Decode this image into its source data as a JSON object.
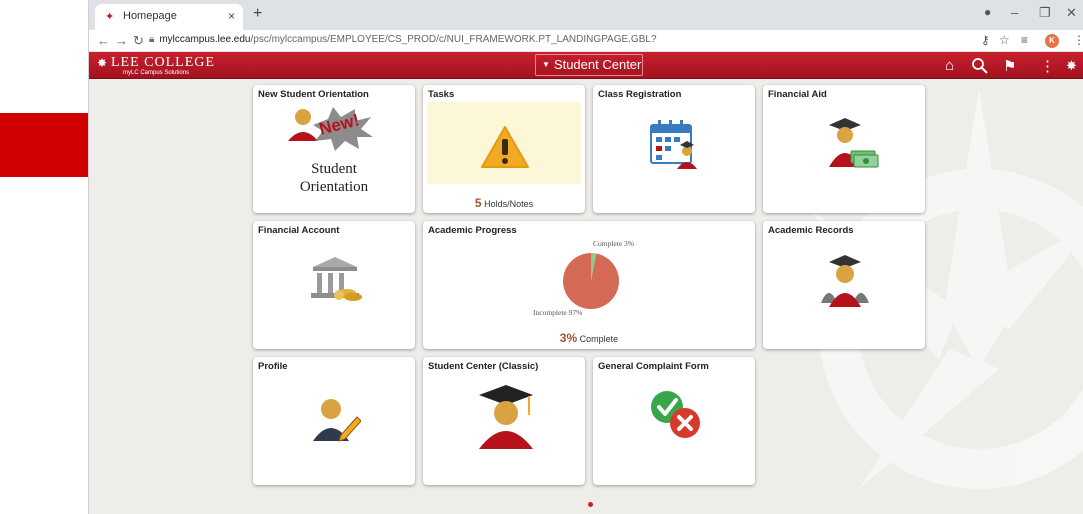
{
  "browser": {
    "tab_title": "Homepage",
    "tab_close": "×",
    "new_tab": "+",
    "url_domain": "mylccampus.lee.edu",
    "url_path": "/psc/mylccampus/EMPLOYEE/CS_PROD/c/NUI_FRAMEWORK.PT_LANDINGPAGE.GBL?",
    "profile_initial": "K",
    "window_controls": [
      "minimize-icon",
      "maximize-icon",
      "close-icon"
    ]
  },
  "header": {
    "logo_name": "LEE COLLEGE",
    "logo_sub": "myLC Campus Solutions",
    "nav_selector": "Student Center",
    "icons": [
      "home-icon",
      "search-icon",
      "flag-icon",
      "more-icon",
      "compass-icon"
    ]
  },
  "tiles": [
    {
      "title": "New Student Orientation",
      "badge": "New!",
      "caption_1": "Student",
      "caption_2": "Orientation",
      "icon": "person-icon"
    },
    {
      "title": "Tasks",
      "count": "5",
      "count_label": "Holds/Notes",
      "icon": "warning-icon"
    },
    {
      "title": "Class Registration",
      "icon": "calendar-icon"
    },
    {
      "title": "Financial Aid",
      "icon": "graduate-money-icon"
    },
    {
      "title": "Financial Account",
      "icon": "bank-icon"
    },
    {
      "title": "Academic Progress",
      "complete_label": "Complete 3%",
      "incomplete_label": "Incomplete 97%",
      "summary_value": "3%",
      "summary_label": "Complete",
      "icon": "pie-icon"
    },
    {
      "title": "Academic Records",
      "icon": "graduate-icon"
    },
    {
      "title": "Profile",
      "icon": "person-edit-icon"
    },
    {
      "title": "Student Center (Classic)",
      "icon": "graduate-icon"
    },
    {
      "title": "General Complaint Form",
      "icon": "check-x-icon"
    }
  ],
  "progress": {
    "complete": 0.03,
    "incomplete": 0.97
  },
  "colors": {
    "brand_red": "#b5121b",
    "accent_orange": "#a0522d",
    "arrow_red": "#d10000"
  }
}
